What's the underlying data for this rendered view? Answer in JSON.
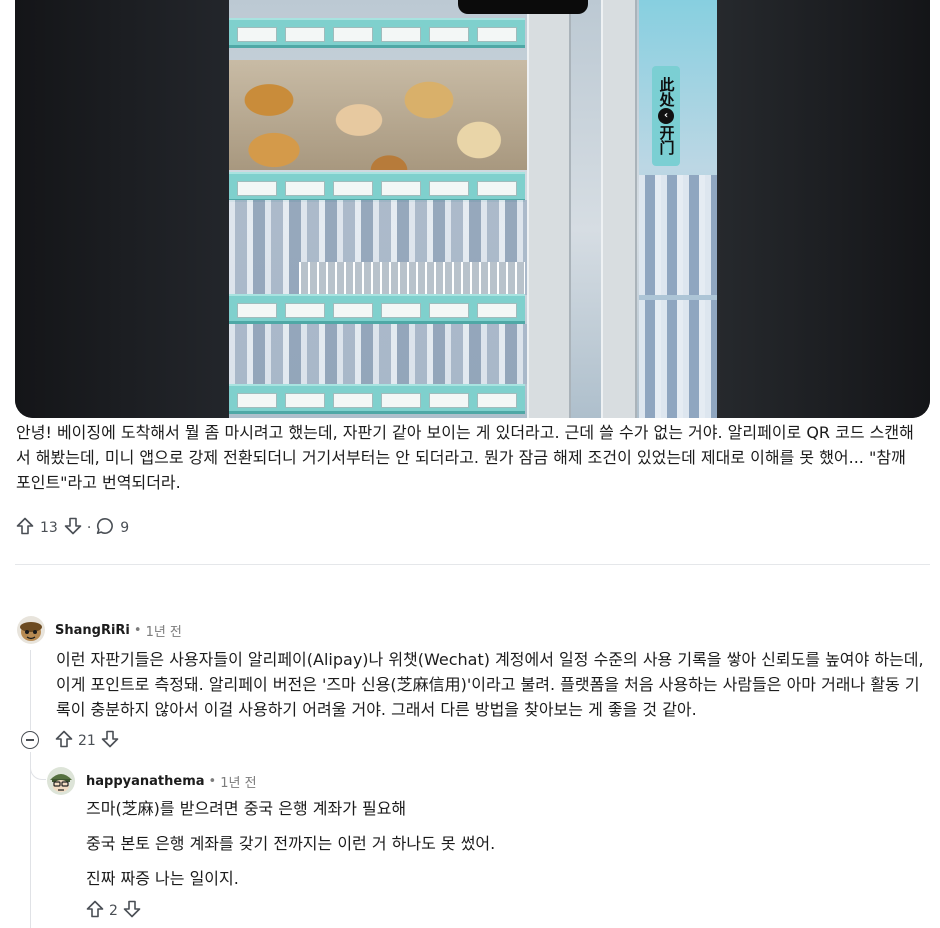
{
  "post": {
    "image": {
      "sign_text_top": "此处",
      "sign_text_bottom": "开门",
      "sign_arrow": "‹"
    },
    "body": "안녕! 베이징에 도착해서 뭘 좀 마시려고 했는데, 자판기 같아 보이는 게 있더라고. 근데 쓸 수가 없는 거야. 알리페이로 QR 코드 스캔해서 해봤는데, 미니 앱으로 강제 전환되더니 거기서부터는 안 되더라고. 뭔가 잠금 해제 조건이 있었는데 제대로 이해를 못 했어... \"참깨 포인트\"라고 번역되더라.",
    "upvotes": "13",
    "separator": "·",
    "comments": "9"
  },
  "comments": [
    {
      "author": "ShangRiRi",
      "separator": "•",
      "time": "1년 전",
      "text": "이런 자판기들은 사용자들이 알리페이(Alipay)나 위챗(Wechat) 계정에서 일정 수준의 사용 기록을 쌓아 신뢰도를 높여야 하는데, 이게 포인트로 측정돼. 알리페이 버전은 '즈마 신용(芝麻信用)'이라고 불려. 플랫폼을 처음 사용하는 사람들은 아마 거래나 활동 기록이 충분하지 않아서 이걸 사용하기 어려울 거야. 그래서 다른 방법을 찾아보는 게 좋을 것 같아.",
      "votes": "21"
    },
    {
      "author": "happyanathema",
      "separator": "•",
      "time": "1년 전",
      "paragraphs": [
        "즈마(芝麻)를 받으려면 중국 은행 계좌가 필요해",
        "중국 본토 은행 계좌를 갖기 전까지는 이런 거 하나도 못 썼어.",
        "진짜 짜증 나는 일이지."
      ],
      "votes": "2"
    }
  ],
  "colors": {
    "text": "#1c1c1c",
    "muted": "#7c7c7c",
    "icon": "#4a4f55",
    "divider": "#e5e7ea",
    "shelf": "#7fd0cd"
  }
}
